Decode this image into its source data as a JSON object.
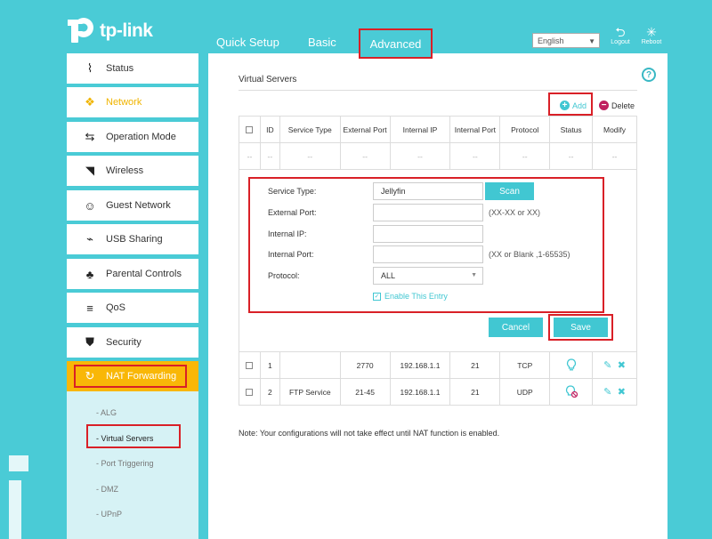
{
  "header": {
    "logo_text": "tp-link",
    "nav": {
      "quick_setup": "Quick Setup",
      "basic": "Basic",
      "advanced": "Advanced"
    },
    "language": "English",
    "logout_label": "Logout",
    "reboot_label": "Reboot"
  },
  "sidebar": {
    "items": [
      {
        "label": "Status",
        "icon": "pulse-icon"
      },
      {
        "label": "Network",
        "icon": "network-icon"
      },
      {
        "label": "Operation Mode",
        "icon": "swap-icon"
      },
      {
        "label": "Wireless",
        "icon": "wifi-icon"
      },
      {
        "label": "Guest Network",
        "icon": "guest-icon"
      },
      {
        "label": "USB Sharing",
        "icon": "usb-icon"
      },
      {
        "label": "Parental Controls",
        "icon": "family-icon"
      },
      {
        "label": "QoS",
        "icon": "qos-icon"
      },
      {
        "label": "Security",
        "icon": "shield-icon"
      },
      {
        "label": "NAT Forwarding",
        "icon": "nat-icon"
      }
    ],
    "sub_items": [
      "- ALG",
      "- Virtual Servers",
      "- Port Triggering",
      "- DMZ",
      "- UPnP"
    ]
  },
  "main": {
    "title": "Virtual Servers",
    "add_label": "Add",
    "delete_label": "Delete",
    "columns": [
      "ID",
      "Service Type",
      "External Port",
      "Internal IP",
      "Internal Port",
      "Protocol",
      "Status",
      "Modify"
    ],
    "dash": "--",
    "form": {
      "service_type_label": "Service Type:",
      "service_type_value": "Jellyfin",
      "scan_label": "Scan",
      "external_port_label": "External Port:",
      "external_port_hint": "(XX-XX or XX)",
      "internal_ip_label": "Internal IP:",
      "internal_port_label": "Internal Port:",
      "internal_port_hint": "(XX or Blank ,1-65535)",
      "protocol_label": "Protocol:",
      "protocol_value": "ALL",
      "enable_label": "Enable This Entry",
      "cancel_label": "Cancel",
      "save_label": "Save"
    },
    "rows": [
      {
        "id": "1",
        "service": "",
        "ext_port": "2770",
        "ip": "192.168.1.1",
        "int_port": "21",
        "protocol": "TCP",
        "status": "enabled"
      },
      {
        "id": "2",
        "service": "FTP Service",
        "ext_port": "21-45",
        "ip": "192.168.1.1",
        "int_port": "21",
        "protocol": "UDP",
        "status": "disabled"
      }
    ],
    "note": "Note: Your configurations will not take effect until NAT function is enabled."
  },
  "colors": {
    "accent": "#41c7d2",
    "highlight": "#f9b707",
    "annotation": "#d92027"
  }
}
